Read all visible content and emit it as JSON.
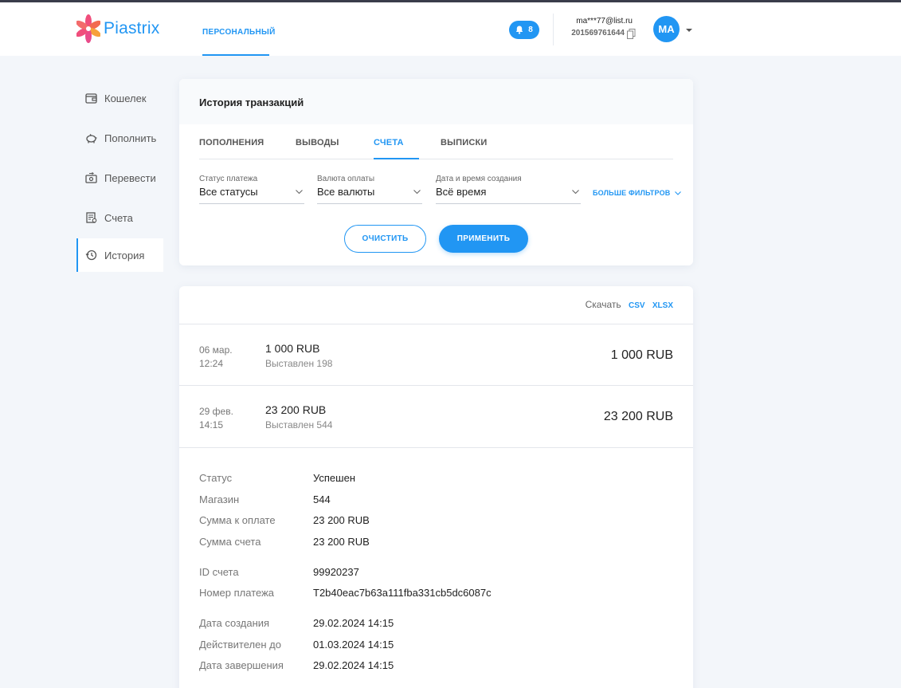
{
  "header": {
    "logo_text": "Piastrix",
    "nav_personal": "ПЕРСОНАЛЬНЫЙ",
    "notifications_count": "8",
    "account_email": "ma***77@list.ru",
    "account_id": "201569761644",
    "avatar_initials": "MA"
  },
  "sidebar": {
    "items": [
      {
        "label": "Кошелек",
        "icon": "wallet-icon"
      },
      {
        "label": "Пополнить",
        "icon": "piggy-bank-icon"
      },
      {
        "label": "Перевести",
        "icon": "transfer-icon"
      },
      {
        "label": "Счета",
        "icon": "invoice-icon"
      },
      {
        "label": "История",
        "icon": "history-icon",
        "active": true
      }
    ]
  },
  "history": {
    "title": "История транзакций",
    "tabs": [
      "ПОПОЛНЕНИЯ",
      "ВЫВОДЫ",
      "СЧЕТА",
      "ВЫПИСКИ"
    ],
    "active_tab": "СЧЕТА",
    "filters": {
      "status": {
        "label": "Статус платежа",
        "value": "Все статусы"
      },
      "currency": {
        "label": "Валюта оплаты",
        "value": "Все валюты"
      },
      "date": {
        "label": "Дата и время создания",
        "value": "Всё время"
      },
      "more": "БОЛЬШЕ ФИЛЬТРОВ"
    },
    "buttons": {
      "clear": "ОЧИСТИТЬ",
      "apply": "ПРИМЕНИТЬ"
    }
  },
  "list": {
    "download_label": "Скачать",
    "download_csv": "CSV",
    "download_xlsx": "XLSX",
    "transactions": [
      {
        "date": "06 мар.",
        "time": "12:24",
        "amount": "1 000 RUB",
        "subtitle": "Выставлен 198",
        "right_amount": "1 000 RUB"
      },
      {
        "date": "29 фев.",
        "time": "14:15",
        "amount": "23 200 RUB",
        "subtitle": "Выставлен 544",
        "right_amount": "23 200 RUB"
      }
    ],
    "details": {
      "status": {
        "key": "Статус",
        "value": "Успешен"
      },
      "shop": {
        "key": "Магазин",
        "value": "544"
      },
      "pay_amount": {
        "key": "Сумма к оплате",
        "value": "23 200 RUB"
      },
      "invoice_amount": {
        "key": "Сумма счета",
        "value": "23 200 RUB"
      },
      "invoice_id": {
        "key": "ID счета",
        "value": "99920237"
      },
      "payment_number": {
        "key": "Номер платежа",
        "value": "T2b40eac7b63a111fba331cb5dc6087c"
      },
      "created": {
        "key": "Дата создания",
        "value": "29.02.2024 14:15"
      },
      "valid_until": {
        "key": "Действителен до",
        "value": "01.03.2024 14:15"
      },
      "completed": {
        "key": "Дата завершения",
        "value": "29.02.2024 14:15"
      }
    }
  },
  "colors": {
    "accent": "#2196f3",
    "background": "#f3f6fa",
    "logo_petals": "#f04e7c"
  }
}
